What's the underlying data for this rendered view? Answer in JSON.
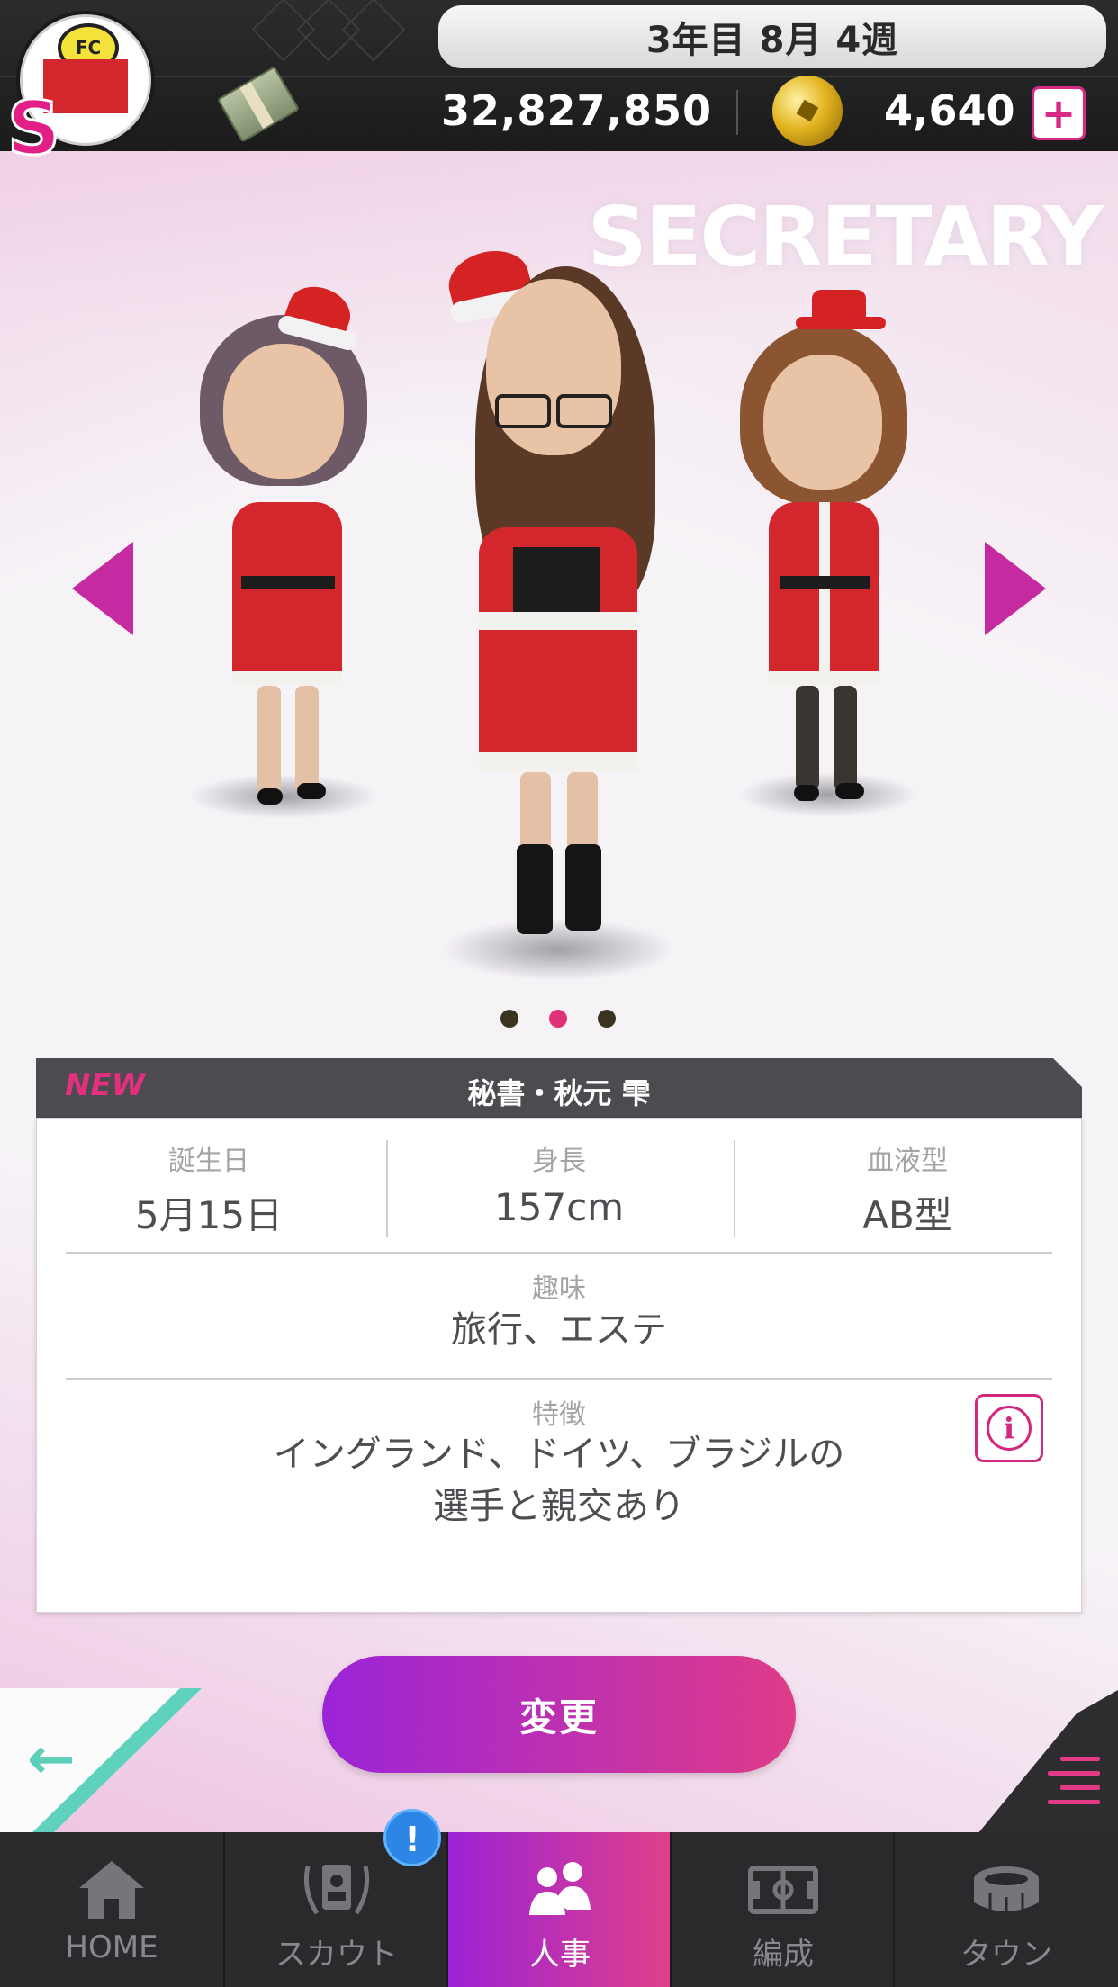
{
  "header": {
    "date_label": "3年目 8月 4週",
    "money": "32,827,850",
    "coins": "4,640",
    "add_coins_symbol": "+",
    "rank_letter": "S",
    "club_emblem_text": "FC",
    "accent_color": "#e2307f"
  },
  "secretary": {
    "section_title": "SECRETARY",
    "carousel_count": 3,
    "carousel_active_index": 1
  },
  "profile": {
    "badge": "NEW",
    "name": "秘書・秋元 雫",
    "stats": [
      {
        "label": "誕生日",
        "value": "5月15日"
      },
      {
        "label": "身長",
        "value": "157cm"
      },
      {
        "label": "血液型",
        "value": "AB型"
      }
    ],
    "hobby_label": "趣味",
    "hobby_value": "旅行、エステ",
    "feature_label": "特徴",
    "feature_line1": "イングランド、ドイツ、ブラジルの",
    "feature_line2": "選手と親交あり",
    "info_symbol": "i"
  },
  "actions": {
    "change_label": "変更",
    "back_symbol": "←"
  },
  "nav": {
    "items": [
      {
        "label": "HOME",
        "icon": "home-icon"
      },
      {
        "label": "スカウト",
        "icon": "scout-icon"
      },
      {
        "label": "人事",
        "icon": "personnel-icon"
      },
      {
        "label": "編成",
        "icon": "formation-icon"
      },
      {
        "label": "タウン",
        "icon": "town-icon"
      }
    ],
    "active_index": 2,
    "alert_symbol": "!"
  }
}
